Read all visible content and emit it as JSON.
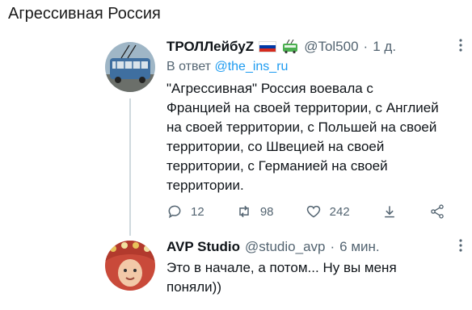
{
  "page": {
    "title": "Агрессивная Россия"
  },
  "tweet1": {
    "name": "ТРОЛЛейбуZ",
    "handle": "@Tol500",
    "dot": "·",
    "time": "1 д.",
    "reply_prefix": "В ответ",
    "reply_handle": "@the_ins_ru",
    "text": "\"Агрессивная\" Россия воевала с\nФранцией на своей территории, с Англией\nна своей территории, с Польшей на своей\nтерритории, со Швецией на своей\nтерритории, с Германией на своей\nтерритории.",
    "icons": {
      "flag": "russia-flag-icon",
      "emoji": "trolleybus-icon"
    },
    "colors": {
      "flag_white": "#ffffff",
      "flag_blue": "#0039a6",
      "flag_red": "#d52b1e"
    },
    "actions": {
      "replies": "12",
      "retweets": "98",
      "likes": "242"
    }
  },
  "tweet2": {
    "name": "AVP Studio",
    "handle": "@studio_avp",
    "dot": "·",
    "time": "6 мин.",
    "text": "Это в начале, а потом... Ну вы меня\nпоняли))"
  },
  "colors": {
    "link": "#1d9bf0",
    "muted": "#536471",
    "text": "#0f1419",
    "thread_line": "#cfd9de"
  }
}
